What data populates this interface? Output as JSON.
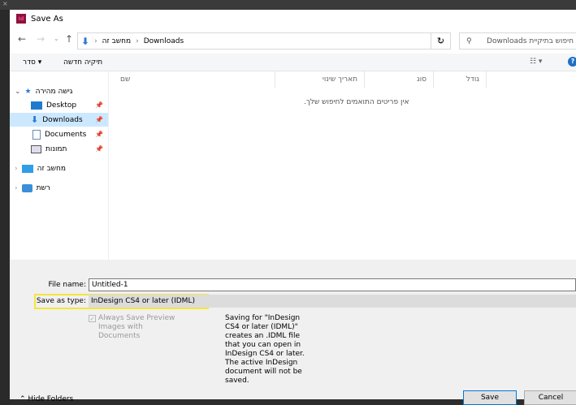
{
  "window": {
    "title": "Save As",
    "bg_marker": "× "
  },
  "address": {
    "crumbs": [
      "מחשב זה",
      "Downloads"
    ],
    "search_placeholder": "חיפוש בתיקיית Downloads"
  },
  "toolbar": {
    "organize": "סדר",
    "new_folder": "תיקיה חדשה"
  },
  "nav": {
    "quick_access": "גישה מהירה",
    "items": [
      "Desktop",
      "Downloads",
      "Documents",
      "תמונות"
    ],
    "this_pc": "מחשב זה",
    "network": "רשת"
  },
  "columns": [
    "שם",
    "תאריך שינוי",
    "סוג",
    "גודל"
  ],
  "empty_message": ".אין פריטים התואמים לחיפוש שלך",
  "form": {
    "file_name_label": "File name:",
    "file_name": "Untitled-1",
    "type_label": "Save as type:",
    "type_value": "InDesign CS4 or later (IDML)",
    "checkbox_label": "Always Save Preview Images with Documents",
    "checkbox_checked": true,
    "description": "Saving for \"InDesign CS4 or later (IDML)\" creates an .IDML file that you can open in InDesign CS4 or later. The active InDesign document will not be saved."
  },
  "buttons": {
    "hide_folders": "Hide Folders",
    "save": "Save",
    "cancel": "Cancel"
  },
  "colors": {
    "highlight": "#f5e63a",
    "selected": "#cce8ff",
    "accent": "#0078d7"
  }
}
